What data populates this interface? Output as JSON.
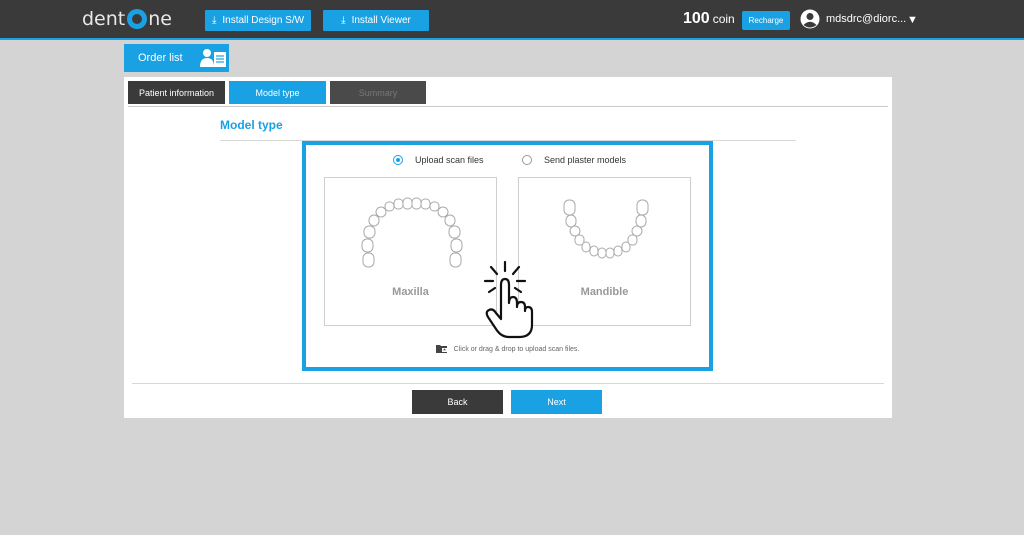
{
  "header": {
    "logo_text_a": "dent",
    "logo_text_b": "ne",
    "install_design": "Install Design S/W",
    "install_viewer": "Install Viewer",
    "coin_value": "100",
    "coin_unit": "coin",
    "recharge": "Recharge",
    "user_email": "mdsdrc@diorc...",
    "user_caret": "▼"
  },
  "order_list": {
    "label": "Order list"
  },
  "steps": [
    {
      "label": "Patient information"
    },
    {
      "label": "Model type"
    },
    {
      "label": "Summary"
    }
  ],
  "section": {
    "title": "Model type"
  },
  "options": {
    "upload_label": "Upload scan files",
    "plaster_label": "Send plaster models",
    "selected": "upload"
  },
  "jaws": {
    "maxilla": "Maxilla",
    "mandible": "Mandible"
  },
  "upload_hint": "Click or drag & drop to upload scan files.",
  "buttons": {
    "back": "Back",
    "next": "Next"
  },
  "colors": {
    "accent": "#19a1e4",
    "topbar": "#3a3a3a",
    "background": "#d4d4d4"
  }
}
